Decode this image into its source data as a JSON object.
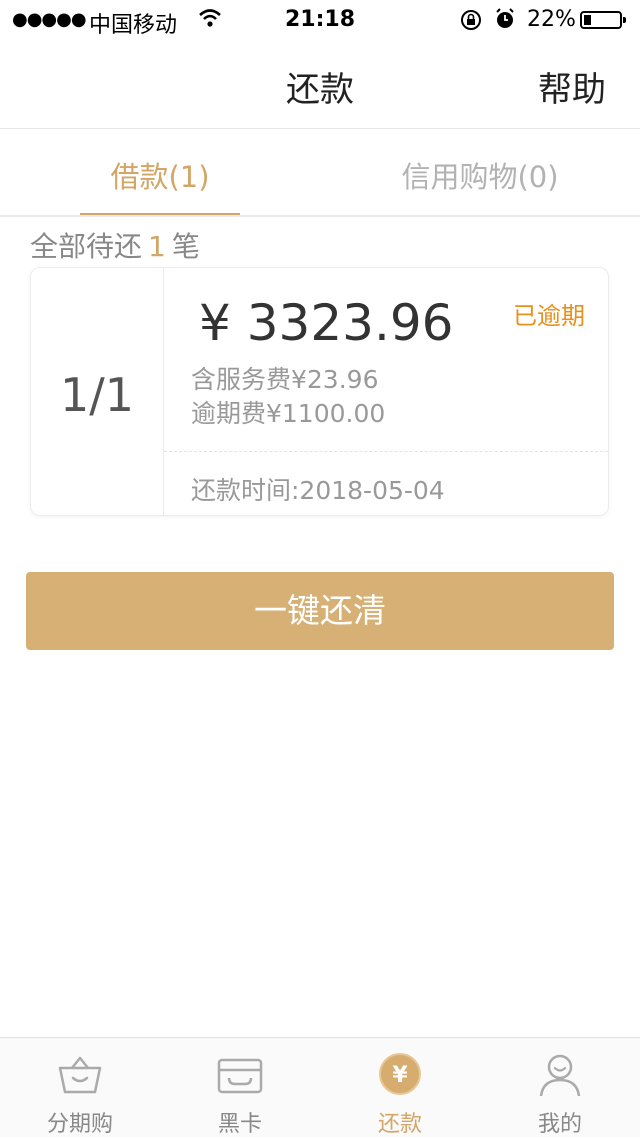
{
  "status_bar": {
    "signal": "●●●●●",
    "carrier": "中国移动",
    "time": "21:18",
    "battery_pct": "22%",
    "battery_level": 0.22
  },
  "nav": {
    "title": "还款",
    "help": "帮助"
  },
  "tabs": [
    {
      "label": "借款(1)",
      "active": true
    },
    {
      "label": "信用购物(0)",
      "active": false
    }
  ],
  "summary": {
    "prefix": "全部待还",
    "count": "1",
    "suffix": "笔"
  },
  "loan_card": {
    "index": "1/1",
    "amount": "¥ 3323.96",
    "status": "已逾期",
    "service_fee": "含服务费¥23.96",
    "late_fee": "逾期费¥1100.00",
    "repay_date": "还款时间:2018-05-04"
  },
  "pay_all_button": "一键还清",
  "tabbar": {
    "items": [
      {
        "label": "分期购",
        "icon": "basket-icon",
        "active": false
      },
      {
        "label": "黑卡",
        "icon": "card-icon",
        "active": false
      },
      {
        "label": "还款",
        "icon": "yen-icon",
        "active": true
      },
      {
        "label": "我的",
        "icon": "user-icon",
        "active": false
      }
    ]
  },
  "colors": {
    "accent": "#d3a566",
    "button": "#d6b074",
    "overdue": "#e8901c"
  }
}
